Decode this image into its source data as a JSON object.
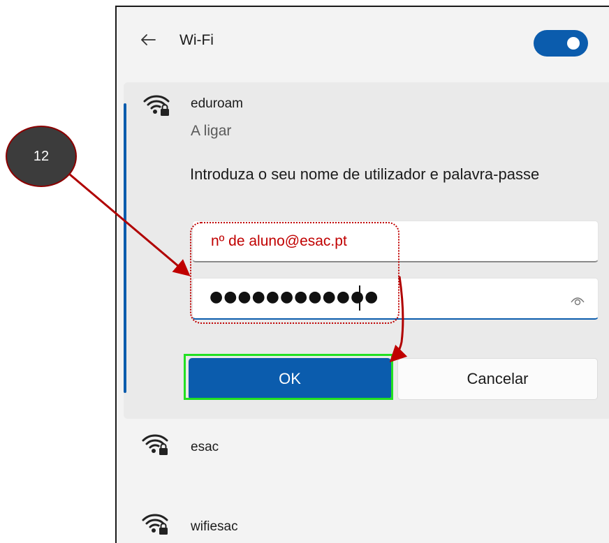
{
  "header": {
    "title": "Wi-Fi",
    "back_icon": "back-arrow-icon",
    "toggle_state": "on"
  },
  "connecting": {
    "network_name": "eduroam",
    "status": "A ligar",
    "prompt": "Introduza o seu nome de utilizador e palavra-passe",
    "username_value": "",
    "password_masked": "●●●●●●●●●●●●",
    "reveal_icon": "eye-icon",
    "ok_label": "OK",
    "cancel_label": "Cancelar"
  },
  "networks": [
    {
      "name": "esac",
      "icon": "wifi-locked-icon"
    },
    {
      "name": "wifiesac",
      "icon": "wifi-locked-icon"
    }
  ],
  "annotations": {
    "step_number": "12",
    "username_hint": "nº de aluno@esac.pt"
  },
  "colors": {
    "accent": "#0b5cad",
    "annotation_red": "#c00000",
    "highlight_green": "#22e022"
  }
}
